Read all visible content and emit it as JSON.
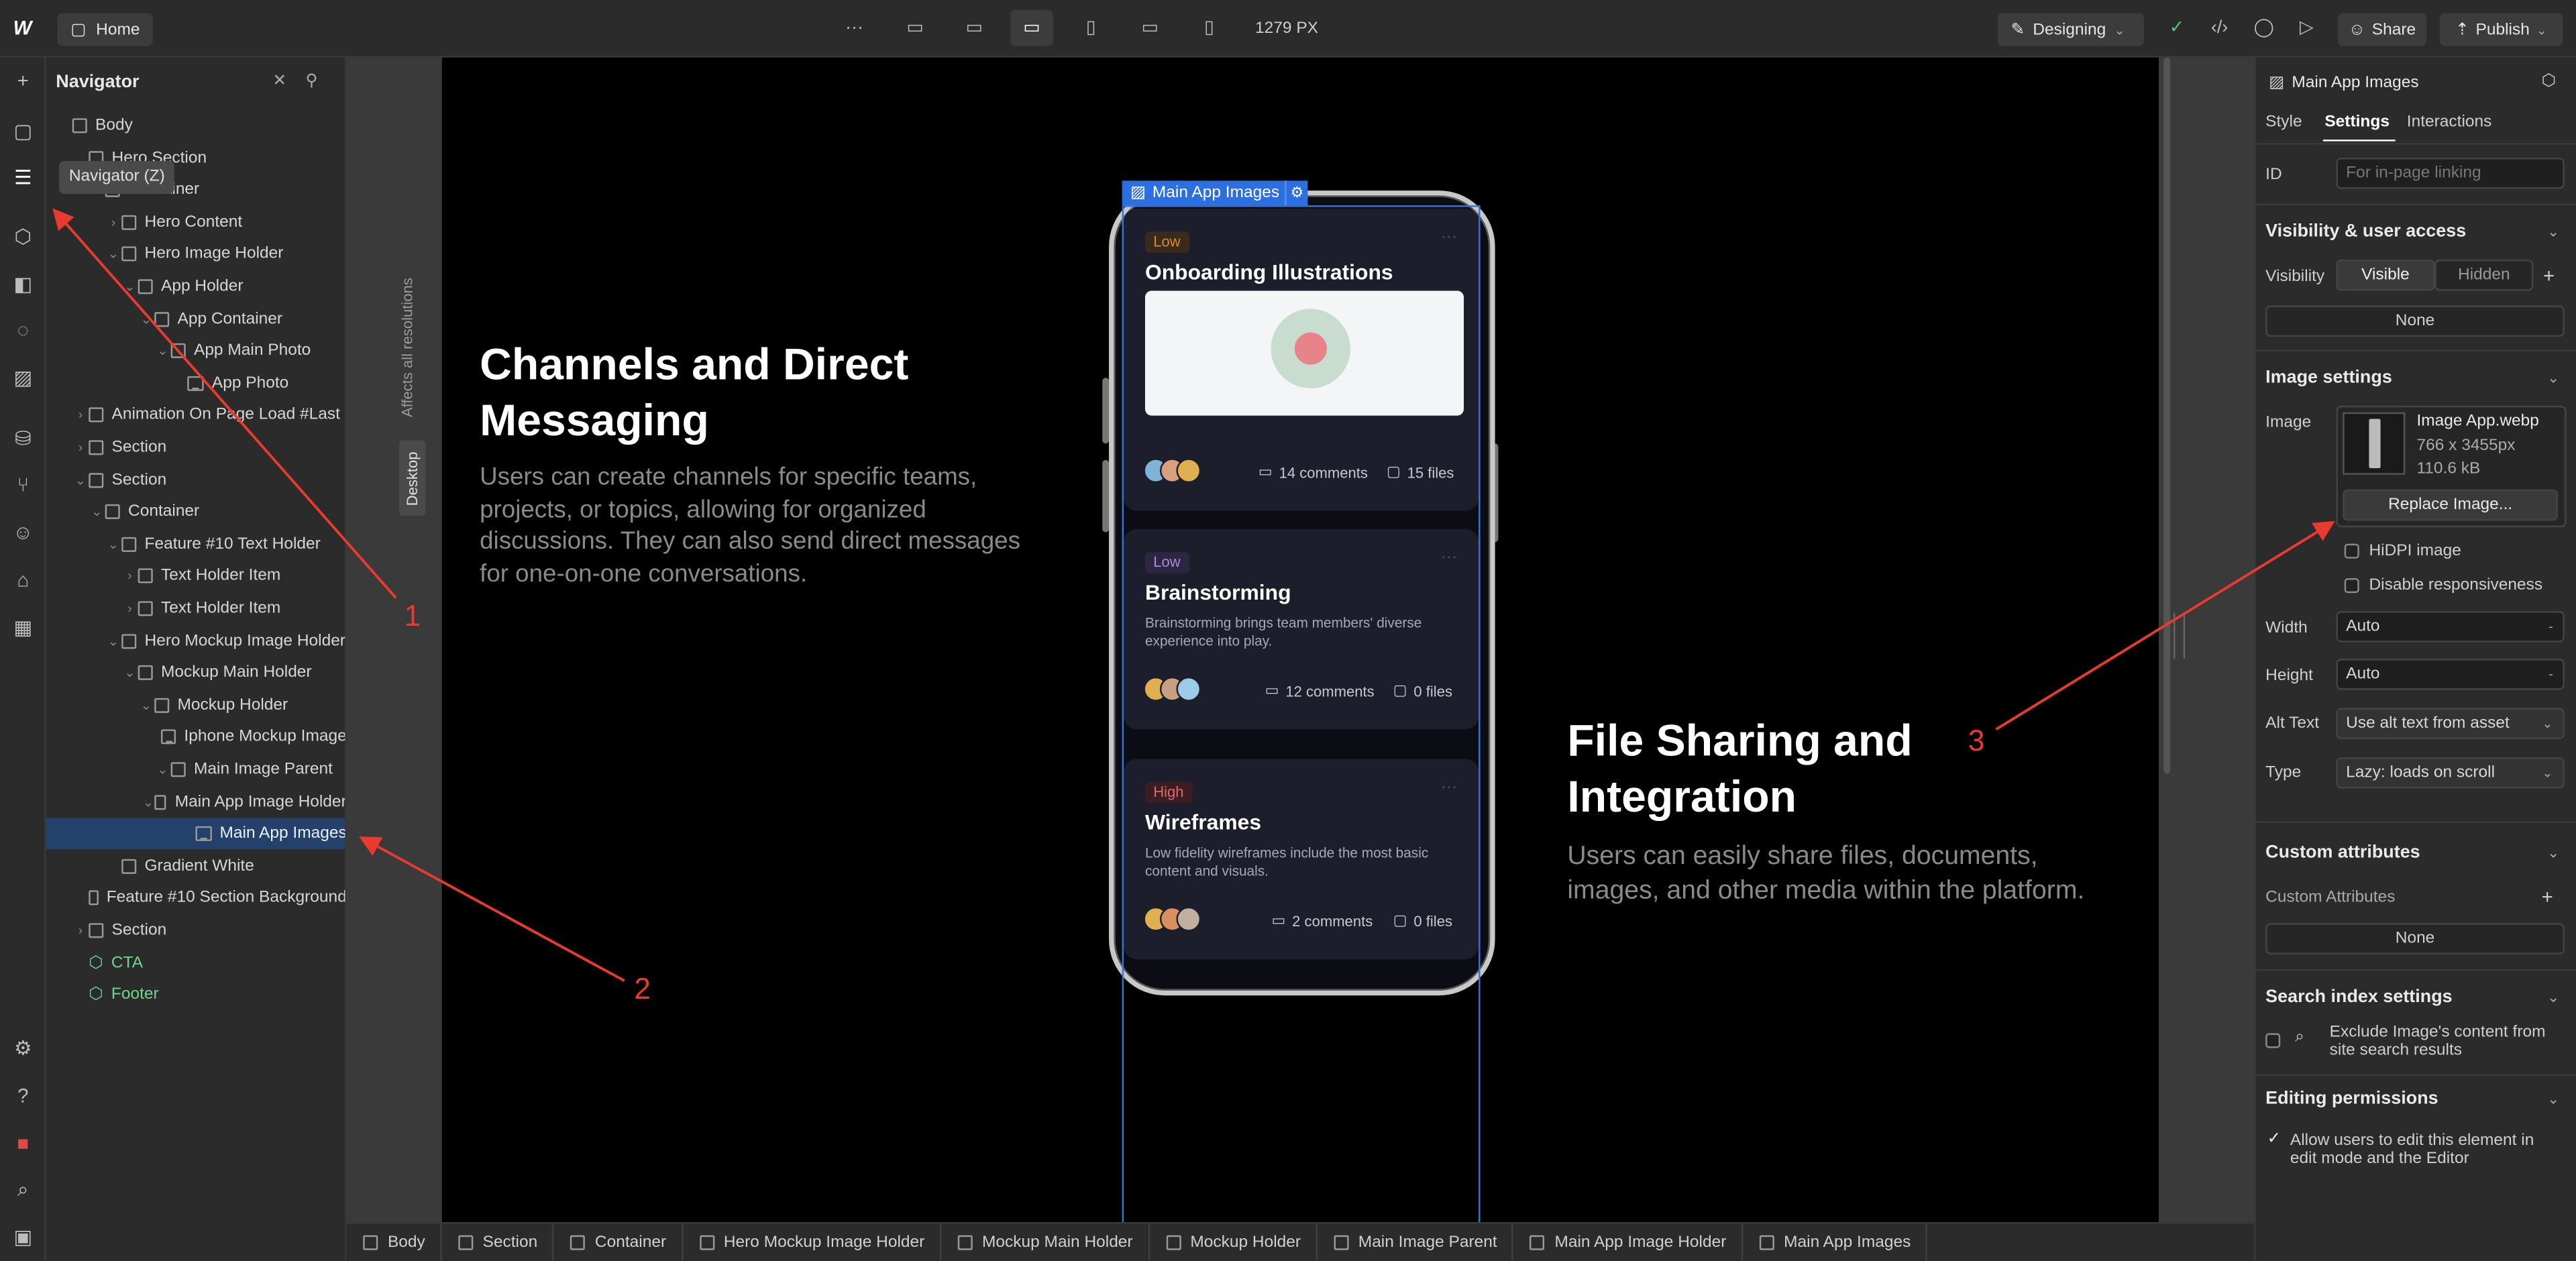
{
  "topbar": {
    "home_label": "Home",
    "width_readout": "1279 PX",
    "mode_label": "Designing",
    "share_label": "Share",
    "publish_label": "Publish"
  },
  "tooltip": "Navigator (Z)",
  "navigator": {
    "title": "Navigator",
    "items": [
      {
        "label": "Body",
        "depth": 0,
        "caret": "",
        "icon": "box"
      },
      {
        "label": "Hero Section",
        "depth": 1,
        "caret": "",
        "icon": "box"
      },
      {
        "label": "Container",
        "depth": 2,
        "caret": "",
        "icon": "box"
      },
      {
        "label": "Hero Content",
        "depth": 3,
        "caret": "›",
        "icon": "box"
      },
      {
        "label": "Hero Image Holder",
        "depth": 3,
        "caret": "⌄",
        "icon": "box"
      },
      {
        "label": "App Holder",
        "depth": 4,
        "caret": "⌄",
        "icon": "box"
      },
      {
        "label": "App Container",
        "depth": 5,
        "caret": "⌄",
        "icon": "box"
      },
      {
        "label": "App Main Photo",
        "depth": 6,
        "caret": "⌄",
        "icon": "box"
      },
      {
        "label": "App Photo",
        "depth": 7,
        "caret": "",
        "icon": "img"
      },
      {
        "label": "Animation On Page Load #Last",
        "depth": 1,
        "caret": "›",
        "icon": "box"
      },
      {
        "label": "Section",
        "depth": 1,
        "caret": "›",
        "icon": "box"
      },
      {
        "label": "Section",
        "depth": 1,
        "caret": "⌄",
        "icon": "box"
      },
      {
        "label": "Container",
        "depth": 2,
        "caret": "⌄",
        "icon": "box"
      },
      {
        "label": "Feature #10 Text Holder",
        "depth": 3,
        "caret": "⌄",
        "icon": "box"
      },
      {
        "label": "Text Holder Item",
        "depth": 4,
        "caret": "›",
        "icon": "box"
      },
      {
        "label": "Text Holder Item",
        "depth": 4,
        "caret": "›",
        "icon": "box"
      },
      {
        "label": "Hero Mockup Image Holder",
        "depth": 3,
        "caret": "⌄",
        "icon": "box"
      },
      {
        "label": "Mockup Main Holder",
        "depth": 4,
        "caret": "⌄",
        "icon": "box"
      },
      {
        "label": "Mockup Holder",
        "depth": 5,
        "caret": "⌄",
        "icon": "box"
      },
      {
        "label": "Iphone Mockup Image",
        "depth": 6,
        "caret": "",
        "icon": "img"
      },
      {
        "label": "Main Image Parent",
        "depth": 6,
        "caret": "⌄",
        "icon": "box"
      },
      {
        "label": "Main App Image Holder",
        "depth": 7,
        "caret": "⌄",
        "icon": "box"
      },
      {
        "label": "Main App Images",
        "depth": 8,
        "caret": "",
        "icon": "img",
        "selected": true
      },
      {
        "label": "Gradient White",
        "depth": 3,
        "caret": "",
        "icon": "box"
      },
      {
        "label": "Feature #10 Section Background",
        "depth": 3,
        "caret": "",
        "icon": "box"
      },
      {
        "label": "Section",
        "depth": 1,
        "caret": "›",
        "icon": "box"
      },
      {
        "label": "CTA",
        "depth": 1,
        "caret": "",
        "icon": "cmp",
        "component": true
      },
      {
        "label": "Footer",
        "depth": 1,
        "caret": "",
        "icon": "cmp",
        "component": true
      }
    ]
  },
  "canvas": {
    "resolution_note": "Affects all resolutions",
    "breakpoint_tab": "Desktop",
    "feature1": {
      "title": "Channels and Direct Messaging",
      "body": "Users can create channels for specific teams, projects, or topics, allowing for organized discussions. They can also send direct messages for one-on-one conversations."
    },
    "feature2": {
      "title": "File Sharing and Integration",
      "body": "Users can easily share files, documents, images, and other media within the platform."
    },
    "selection_label": "Main App Images",
    "cards": [
      {
        "badge": "Low",
        "badge_color": "#d98a3a",
        "badge_bg": "#3a2a1c",
        "title": "Onboarding Illustrations",
        "desc": "",
        "comments": "14 comments",
        "files": "15 files"
      },
      {
        "badge": "Low",
        "badge_color": "#a98ae0",
        "badge_bg": "#2d2640",
        "title": "Brainstorming",
        "desc": "Brainstorming brings team members' diverse experience into play.",
        "comments": "12 comments",
        "files": "0 files"
      },
      {
        "badge": "High",
        "badge_color": "#e06a6a",
        "badge_bg": "#3a1e22",
        "title": "Wireframes",
        "desc": "Low fidelity wireframes include the most basic content and visuals.",
        "comments": "2 comments",
        "files": "0 files"
      }
    ]
  },
  "breadcrumbs": [
    "Body",
    "Section",
    "Container",
    "Hero Mockup Image Holder",
    "Mockup Main Holder",
    "Mockup Holder",
    "Main Image Parent",
    "Main App Image Holder",
    "Main App Images"
  ],
  "panel": {
    "element_name": "Main App Images",
    "tabs": [
      "Style",
      "Settings",
      "Interactions"
    ],
    "active_tab": "Settings",
    "id_label": "ID",
    "id_placeholder": "For in-page linking",
    "visibility_section": "Visibility & user access",
    "visibility_label": "Visibility",
    "visible_label": "Visible",
    "hidden_label": "Hidden",
    "visibility_none": "None",
    "image_section": "Image settings",
    "image_label": "Image",
    "image_filename": "Image App.webp",
    "image_dims": "766 x 3455px",
    "image_size": "110.6 kB",
    "replace_label": "Replace Image...",
    "hidpi_label": "HiDPI image",
    "disable_resp_label": "Disable responsiveness",
    "width_label": "Width",
    "width_value": "Auto",
    "height_label": "Height",
    "height_value": "Auto",
    "alt_label": "Alt Text",
    "alt_value": "Use alt text from asset",
    "type_label": "Type",
    "type_value": "Lazy: loads on scroll",
    "custom_attr_section": "Custom attributes",
    "custom_attr_label": "Custom Attributes",
    "custom_attr_none": "None",
    "search_section": "Search index settings",
    "search_exclude_label": "Exclude Image's content from site search results",
    "editing_section": "Editing permissions",
    "editing_label": "Allow users to edit this element in edit mode and the Editor"
  },
  "annotations": [
    "1",
    "2",
    "3"
  ],
  "colors": {
    "accent": "#2c6fe0",
    "annotation": "#e83a2e",
    "selected_row": "#24416b"
  }
}
